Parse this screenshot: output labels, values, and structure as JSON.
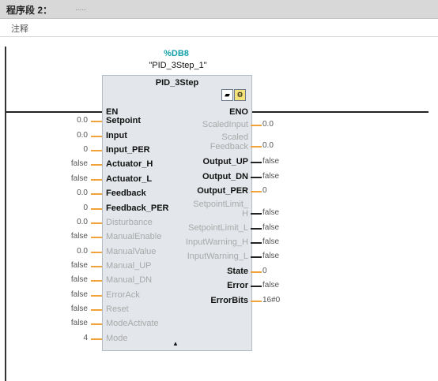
{
  "network": {
    "title": "程序段 2：",
    "title_value": ".....",
    "comment": "注释"
  },
  "block": {
    "db_number": "%DB8",
    "instance_name": "\"PID_3Step_1\"",
    "type": "PID_3Step",
    "en_label": "EN",
    "eno_label": "ENO",
    "icon_left": "block-properties-icon",
    "icon_right": "commissioning-icon",
    "wire_color": "#f2a23a",
    "db_color": "#17a0a8"
  },
  "inputs": [
    {
      "name": "Setpoint",
      "value": "0.0"
    },
    {
      "name": "Input",
      "value": "0.0"
    },
    {
      "name": "Input_PER",
      "value": "0"
    },
    {
      "name": "Actuator_H",
      "value": "false"
    },
    {
      "name": "Actuator_L",
      "value": "false"
    },
    {
      "name": "Feedback",
      "value": "0.0"
    },
    {
      "name": "Feedback_PER",
      "value": "0"
    },
    {
      "name": "Disturbance",
      "value": "0.0"
    },
    {
      "name": "ManualEnable",
      "value": "false"
    },
    {
      "name": "ManualValue",
      "value": "0.0"
    },
    {
      "name": "Manual_UP",
      "value": "false"
    },
    {
      "name": "Manual_DN",
      "value": "false"
    },
    {
      "name": "ErrorAck",
      "value": "false"
    },
    {
      "name": "Reset",
      "value": "false"
    },
    {
      "name": "ModeActivate",
      "value": "false"
    },
    {
      "name": "Mode",
      "value": "4"
    }
  ],
  "outputs": [
    {
      "name": "ScaledInput",
      "value": "0.0"
    },
    {
      "name": "Scaled",
      "name2": "Feedback",
      "value": "0.0"
    },
    {
      "name": "Output_UP",
      "value": "false"
    },
    {
      "name": "Output_DN",
      "value": "false"
    },
    {
      "name": "Output_PER",
      "value": "0"
    },
    {
      "name": "SetpointLimit_",
      "name2": "H",
      "value": "false"
    },
    {
      "name": "SetpointLimit_L",
      "value": "false"
    },
    {
      "name": "InputWarning_H",
      "value": "false"
    },
    {
      "name": "InputWarning_L",
      "value": "false"
    },
    {
      "name": "State",
      "value": "0"
    },
    {
      "name": "Error",
      "value": "false"
    },
    {
      "name": "ErrorBits",
      "value": "16#0"
    }
  ]
}
